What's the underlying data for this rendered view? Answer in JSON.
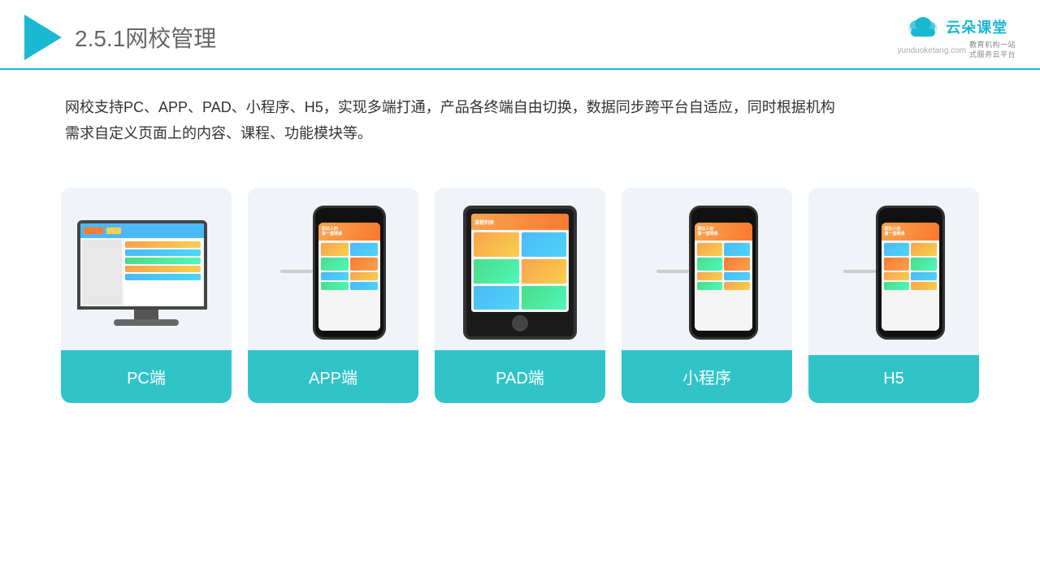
{
  "header": {
    "title": "2.5.1",
    "title_zh": "网校管理",
    "brand_name": "云朵课堂",
    "brand_url": "yunduoketang.com",
    "brand_tagline_1": "教育机构一站",
    "brand_tagline_2": "式服务云平台"
  },
  "description": {
    "line1": "网校支持PC、APP、PAD、小程序、H5，实现多端打通，产品各终端自由切换，数据同步跨平台自适应，同时根据机构",
    "line2": "需求自定义页面上的内容、课程、功能模块等。"
  },
  "cards": [
    {
      "id": "pc",
      "label": "PC端"
    },
    {
      "id": "app",
      "label": "APP端"
    },
    {
      "id": "pad",
      "label": "PAD端"
    },
    {
      "id": "miniprogram",
      "label": "小程序"
    },
    {
      "id": "h5",
      "label": "H5"
    }
  ]
}
